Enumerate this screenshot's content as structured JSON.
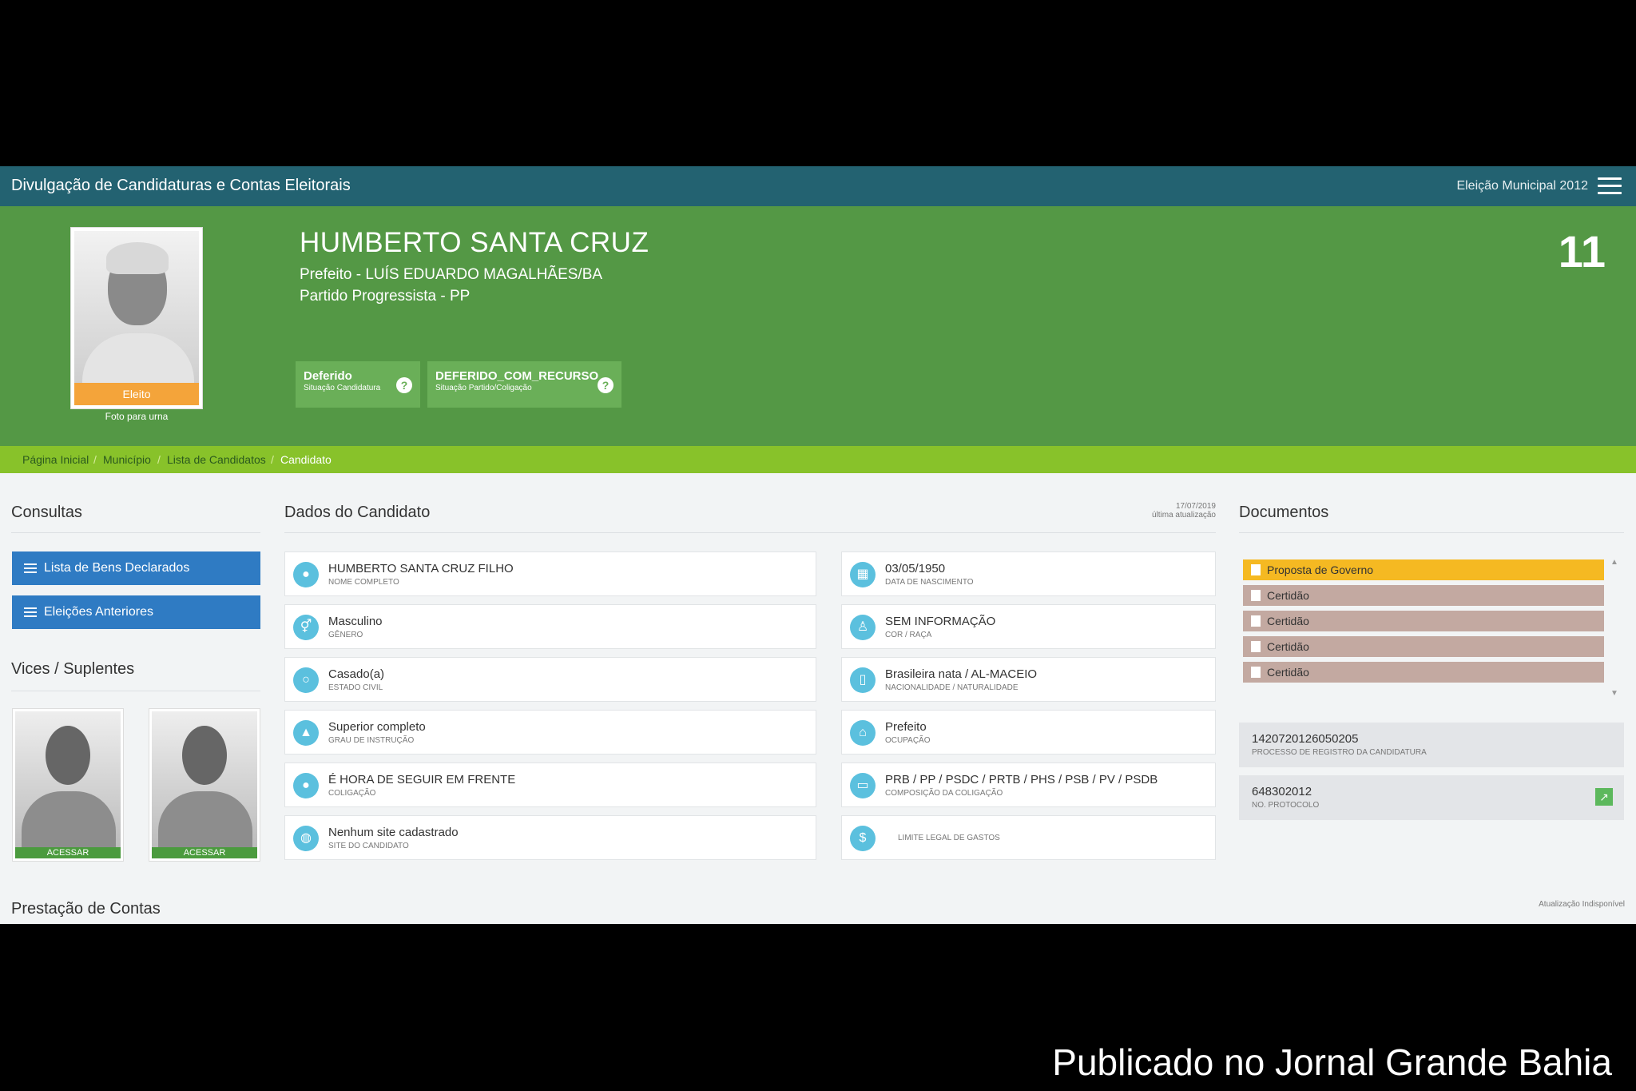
{
  "header": {
    "title": "Divulgação de Candidaturas e Contas Eleitorais",
    "election": "Eleição Municipal 2012"
  },
  "candidate": {
    "name": "HUMBERTO SANTA CRUZ",
    "role": "Prefeito - LUÍS EDUARDO MAGALHÃES/BA",
    "party": "Partido Progressista - PP",
    "number": "11",
    "photo_badge": "Eleito",
    "photo_caption": "Foto para urna",
    "status": [
      {
        "value": "Deferido",
        "label": "Situação Candidatura"
      },
      {
        "value": "DEFERIDO_COM_RECURSO",
        "label": "Situação Partido/Coligação"
      }
    ]
  },
  "breadcrumb": [
    "Página Inicial",
    "Município",
    "Lista de Candidatos",
    "Candidato"
  ],
  "consultas": {
    "title": "Consultas",
    "buttons": [
      "Lista de Bens Declarados",
      "Eleições Anteriores"
    ]
  },
  "vices": {
    "title": "Vices / Suplentes",
    "items": [
      {
        "label": "ACESSAR"
      },
      {
        "label": "ACESSAR"
      }
    ]
  },
  "dados": {
    "title": "Dados do Candidato",
    "updated_date": "17/07/2019",
    "updated_label": "última atualização",
    "left": [
      {
        "value": "HUMBERTO SANTA CRUZ FILHO",
        "label": "NOME COMPLETO",
        "icon": "user-icon"
      },
      {
        "value": "Masculino",
        "label": "GÊNERO",
        "icon": "gender-icon"
      },
      {
        "value": "Casado(a)",
        "label": "ESTADO CIVIL",
        "icon": "ring-icon"
      },
      {
        "value": "Superior completo",
        "label": "GRAU DE INSTRUÇÃO",
        "icon": "graduation-cap-icon"
      },
      {
        "value": "É HORA DE SEGUIR EM FRENTE",
        "label": "COLIGAÇÃO",
        "icon": "group-icon"
      },
      {
        "value": "Nenhum site cadastrado",
        "label": "SITE DO CANDIDATO",
        "icon": "globe-icon"
      }
    ],
    "right": [
      {
        "value": "03/05/1950",
        "label": "DATA DE NASCIMENTO",
        "icon": "calendar-icon"
      },
      {
        "value": "SEM INFORMAÇÃO",
        "label": "COR / RAÇA",
        "icon": "person-icon"
      },
      {
        "value": "Brasileira nata / AL-MACEIO",
        "label": "NACIONALIDADE / NATURALIDADE",
        "icon": "map-icon"
      },
      {
        "value": "Prefeito",
        "label": "OCUPAÇÃO",
        "icon": "building-icon"
      },
      {
        "value": "PRB / PP / PSDC / PRTB / PHS / PSB / PV / PSDB",
        "label": "COMPOSIÇÃO DA COLIGAÇÃO",
        "icon": "folder-icon"
      },
      {
        "value": "",
        "label": "LIMITE LEGAL DE GASTOS",
        "icon": "dollar-icon"
      }
    ]
  },
  "documentos": {
    "title": "Documentos",
    "items": [
      "Proposta de Governo",
      "Certidão",
      "Certidão",
      "Certidão",
      "Certidão"
    ],
    "process": {
      "value": "1420720126050205",
      "label": "PROCESSO DE REGISTRO DA CANDIDATURA"
    },
    "protocol": {
      "value": "648302012",
      "label": "NO. PROTOCOLO"
    }
  },
  "prestacao": {
    "title": "Prestação de Contas",
    "status": "Atualização Indisponível"
  },
  "watermark": "Publicado no Jornal Grande Bahia",
  "colors": {
    "topbar": "#236271",
    "hero": "#549845",
    "breadcrumb": "#88c22a",
    "button_blue": "#2f7bc3",
    "badge_orange": "#f4a43a",
    "doc_gold": "#f5b922",
    "doc_brown": "#c3a9a1",
    "icon_cyan": "#5bc0de"
  }
}
